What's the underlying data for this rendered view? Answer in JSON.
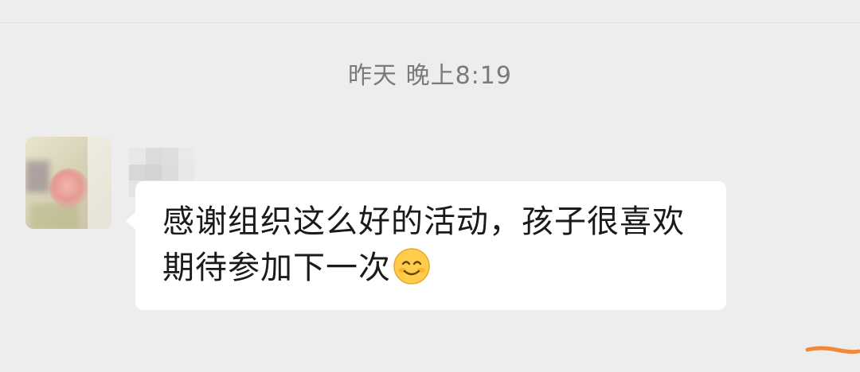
{
  "chat": {
    "timestamp": "昨天 晚上8:19",
    "messages": [
      {
        "direction": "incoming",
        "sender_name_redacted": true,
        "text": "感谢组织这么好的活动，孩子很喜欢期待参加下一次",
        "emoji": "smiling-face-with-smiling-eyes"
      }
    ]
  },
  "colors": {
    "background": "#ededed",
    "bubble": "#ffffff",
    "timestamp_text": "#7a7a7a",
    "message_text": "#1a1a1a",
    "emoji_yellow": "#ffcc4d",
    "emoji_blush": "#f4900c",
    "orange_mark": "#f0883e"
  }
}
